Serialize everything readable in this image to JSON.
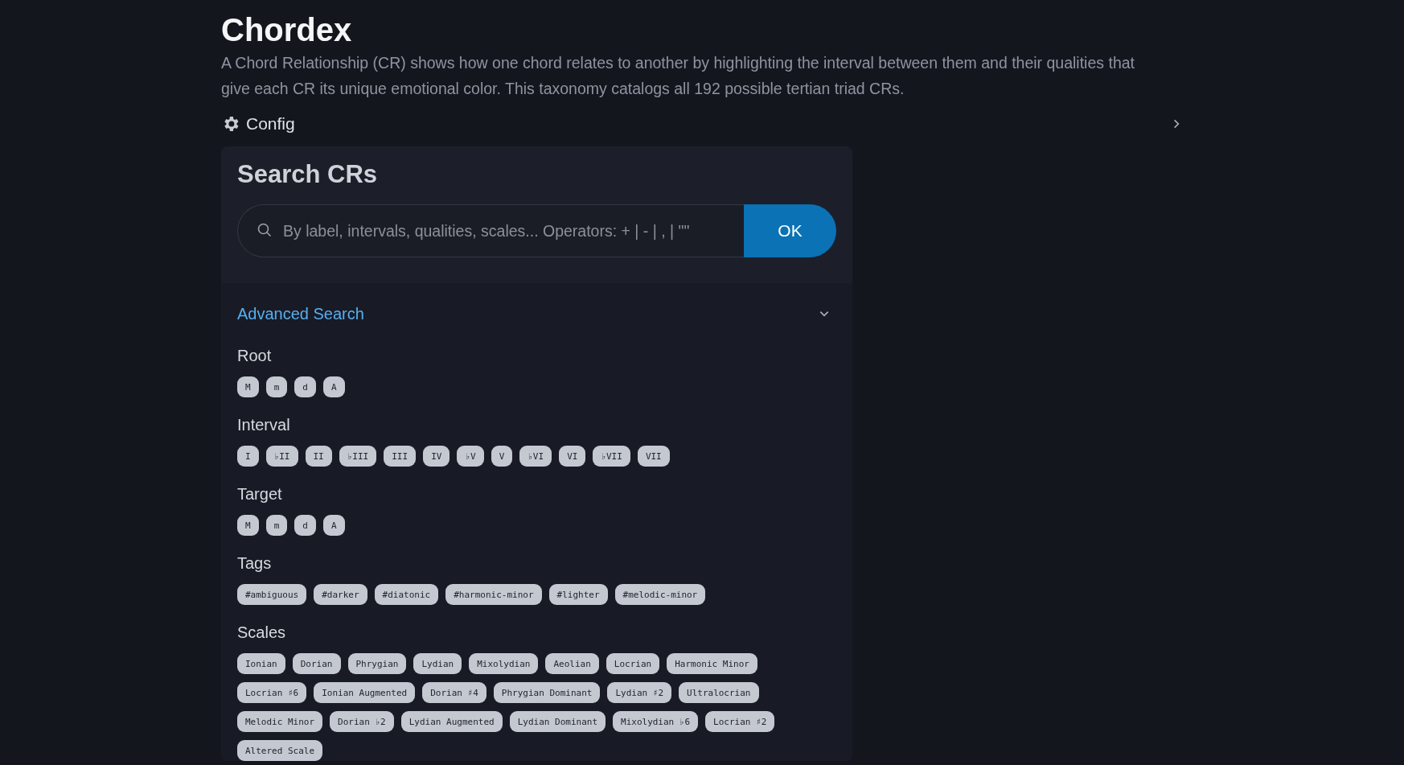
{
  "title": "Chordex",
  "description": "A Chord Relationship (CR) shows how one chord relates to another by highlighting the interval between them and their qualities that give each CR its unique emotional color. This taxonomy catalogs all 192 possible tertian triad CRs.",
  "config": {
    "label": "Config",
    "expanded": false
  },
  "search": {
    "title": "Search CRs",
    "placeholder": "By label, intervals, qualities, scales... Operators: + | - | , | \"\"",
    "button": "OK"
  },
  "advanced": {
    "label": "Advanced Search",
    "expanded": true,
    "sections": [
      {
        "label": "Root",
        "chips": [
          "M",
          "m",
          "d",
          "A"
        ]
      },
      {
        "label": "Interval",
        "chips": [
          "I",
          "♭II",
          "II",
          "♭III",
          "III",
          "IV",
          "♭V",
          "V",
          "♭VI",
          "VI",
          "♭VII",
          "VII"
        ]
      },
      {
        "label": "Target",
        "chips": [
          "M",
          "m",
          "d",
          "A"
        ]
      },
      {
        "label": "Tags",
        "chips": [
          "#ambiguous",
          "#darker",
          "#diatonic",
          "#harmonic-minor",
          "#lighter",
          "#melodic-minor"
        ]
      },
      {
        "label": "Scales",
        "chips": [
          "Ionian",
          "Dorian",
          "Phrygian",
          "Lydian",
          "Mixolydian",
          "Aeolian",
          "Locrian",
          "Harmonic Minor",
          "Locrian ♯6",
          "Ionian Augmented",
          "Dorian ♯4",
          "Phrygian Dominant",
          "Lydian ♯2",
          "Ultralocrian",
          "Melodic Minor",
          "Dorian ♭2",
          "Lydian Augmented",
          "Lydian Dominant",
          "Mixolydian ♭6",
          "Locrian ♯2",
          "Altered Scale"
        ]
      }
    ]
  }
}
